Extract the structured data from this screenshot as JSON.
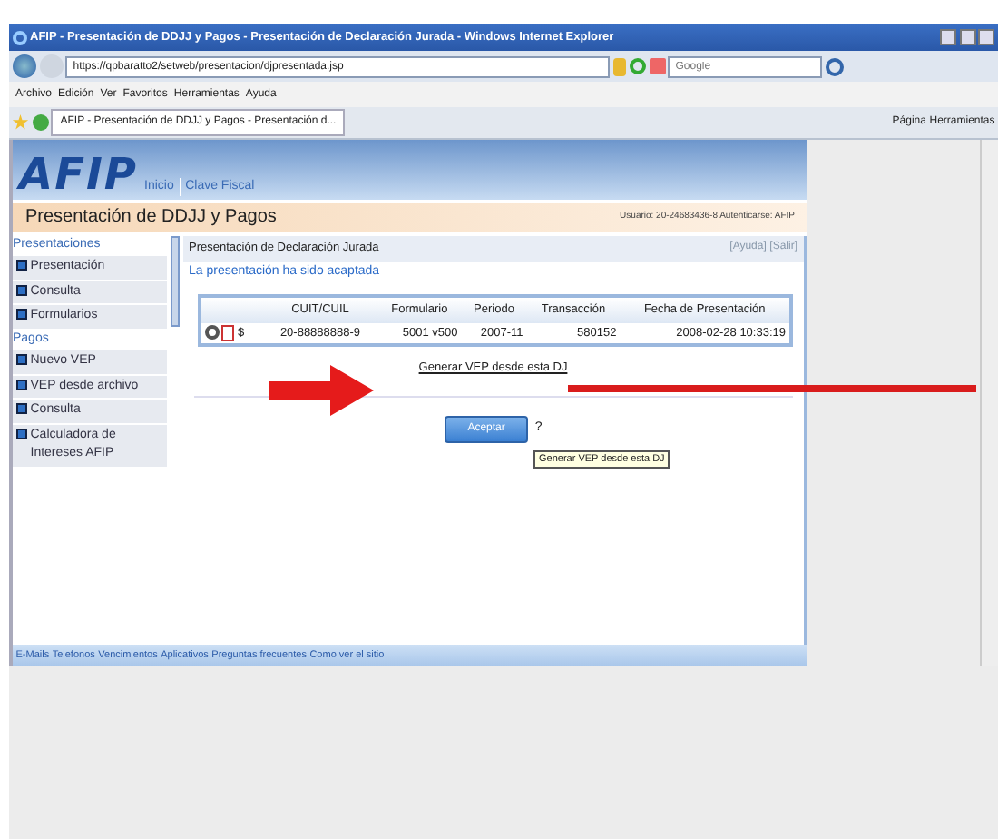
{
  "browser": {
    "title": "AFIP - Presentación de DDJJ y Pagos - Presentación de Declaración Jurada - Windows Internet Explorer",
    "address": "https://qpbaratto2/setweb/presentacion/djpresentada.jsp",
    "search_placeholder": "Google",
    "menu": [
      "Archivo",
      "Edición",
      "Ver",
      "Favoritos",
      "Herramientas",
      "Ayuda"
    ],
    "tab_title": "AFIP - Presentación de DDJJ y Pagos - Presentación d...",
    "toolbar": [
      "Página",
      "Herramientas"
    ]
  },
  "site": {
    "logo": "AFIP",
    "nav": [
      "Inicio",
      "Clave Fiscal"
    ],
    "page_title": "Presentación de DDJJ y Pagos",
    "user_info": "Usuario: 20-24683436-8 Autenticarse: AFIP",
    "sidebar": [
      {
        "heading": "Presentaciones",
        "items": [
          "Presentación",
          "Consulta",
          "Formularios"
        ]
      },
      {
        "heading": "Pagos",
        "items": [
          "Nuevo VEP",
          "VEP desde archivo",
          "Consulta",
          "Calculadora de Intereses AFIP"
        ]
      }
    ],
    "panel": {
      "title": "Presentación de Declaración Jurada",
      "links": [
        "[Ayuda]",
        "[Salir]"
      ],
      "message": "La presentación ha sido acaptada",
      "table": {
        "columns": [
          "CUIT/CUIL",
          "Formulario",
          "Periodo",
          "Transacción",
          "Fecha de Presentación"
        ],
        "rows": [
          {
            "mark": "$",
            "cells": [
              "20-88888888-9",
              "5001 v500",
              "2007-11",
              "580152",
              "2008-02-28 10:33:19"
            ]
          }
        ]
      },
      "action_link": "Generar VEP desde esta DJ",
      "button": "Aceptar",
      "help": "?",
      "tooltip": "Generar VEP desde esta DJ"
    },
    "footer": [
      "E-Mails",
      "Telefonos",
      "Vencimientos",
      "Aplicativos",
      "Preguntas frecuentes",
      "Como ver el sitio"
    ]
  }
}
